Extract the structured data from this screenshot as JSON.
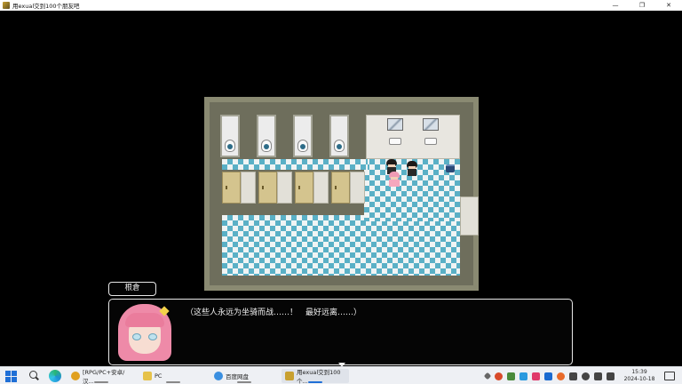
{
  "window": {
    "title": "用exual交到100个朋友吧",
    "minimize": "—",
    "maximize": "❐",
    "close": "✕"
  },
  "dialogue": {
    "speaker": "根倉",
    "message": "（这些人永远为坐骑而战……！　最好远离……）"
  },
  "taskbar": {
    "apps": [
      {
        "label": "[RPG/PC+安卓/汉...",
        "icon": "chrome-icon",
        "color": "#e0a020"
      },
      {
        "label": "PC",
        "icon": "folder-icon",
        "color": "#e6c24a"
      },
      {
        "label": "百度网盘",
        "icon": "baidu-netdisk-icon",
        "color": "#3a8fe0"
      },
      {
        "label": "用exual交到100个...",
        "icon": "game-icon",
        "color": "#c8a030"
      }
    ],
    "clock_time": "15:39",
    "clock_date": "2024-10-18"
  }
}
